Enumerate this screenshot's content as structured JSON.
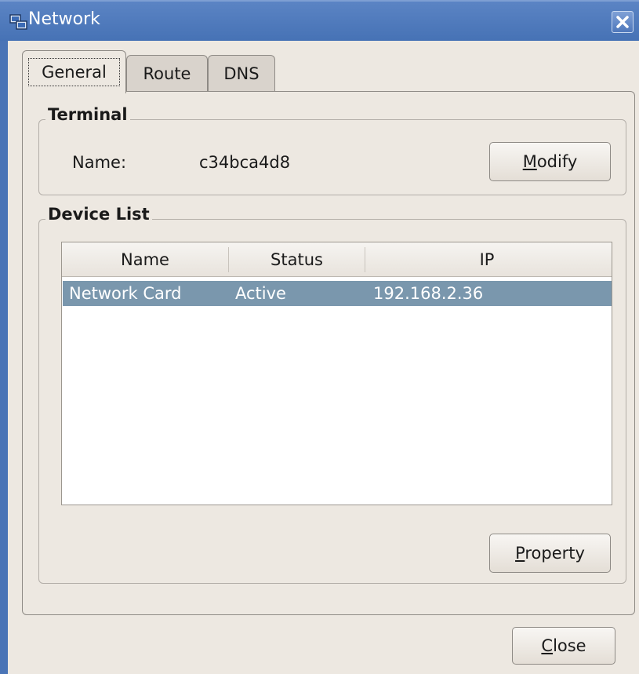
{
  "window": {
    "title": "Network",
    "icon": "network-icon",
    "close_icon": "close-icon"
  },
  "tabs": [
    {
      "label": "General",
      "active": true
    },
    {
      "label": "Route",
      "active": false
    },
    {
      "label": "DNS",
      "active": false
    }
  ],
  "terminal": {
    "frame_label": "Terminal",
    "name_label": "Name:",
    "name_value": "c34bca4d8",
    "modify_mnemonic": "M",
    "modify_rest": "odify"
  },
  "device_list": {
    "frame_label": "Device List",
    "columns": [
      "Name",
      "Status",
      "IP"
    ],
    "rows": [
      {
        "name": "Network Card",
        "status": "Active",
        "ip": "192.168.2.36",
        "selected": true
      }
    ],
    "property_mnemonic": "P",
    "property_rest": "roperty"
  },
  "footer": {
    "close_mnemonic": "C",
    "close_rest": "lose"
  },
  "colors": {
    "titlebar": "#4a74b6",
    "window_bg": "#ede8e1",
    "selection": "#7a97ad"
  }
}
